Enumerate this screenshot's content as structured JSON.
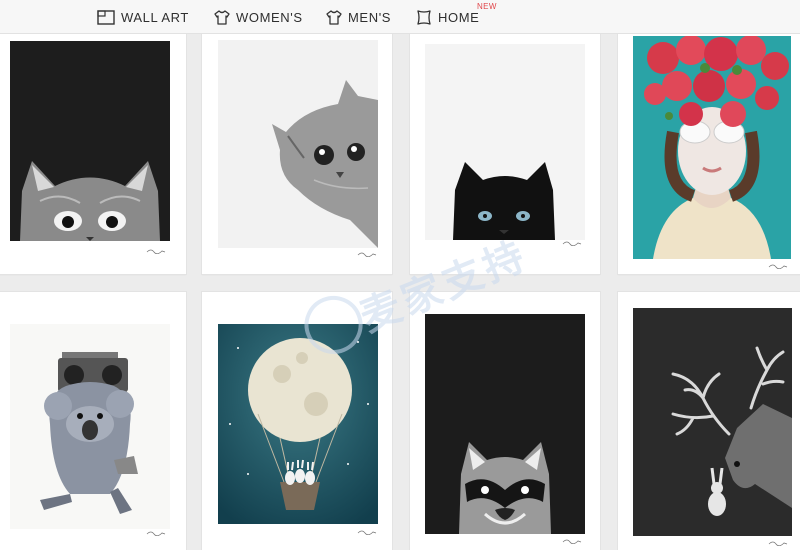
{
  "nav": {
    "items": [
      {
        "label": "WALL ART",
        "icon": "frame-icon"
      },
      {
        "label": "WOMEN'S",
        "icon": "tshirt-icon"
      },
      {
        "label": "MEN'S",
        "icon": "tshirt-icon"
      },
      {
        "label": "HOME",
        "icon": "pillow-icon"
      }
    ],
    "home_badge": "NEW"
  },
  "watermark": {
    "text": "麦家支持"
  },
  "products": [
    {
      "subject": "cat peeking over edge (black background)"
    },
    {
      "subject": "cat peeking from side"
    },
    {
      "subject": "black cat peeking"
    },
    {
      "subject": "girl with flower crown and glasses"
    },
    {
      "subject": "koala with boombox"
    },
    {
      "subject": "moon hot-air balloon with bunnies"
    },
    {
      "subject": "raccoon on black"
    },
    {
      "subject": "deer and rabbit"
    }
  ],
  "colors": {
    "nav_text": "#2f2f2f",
    "badge": "#e0464a",
    "page_bg": "#ececec",
    "card_bg": "#ffffff"
  }
}
